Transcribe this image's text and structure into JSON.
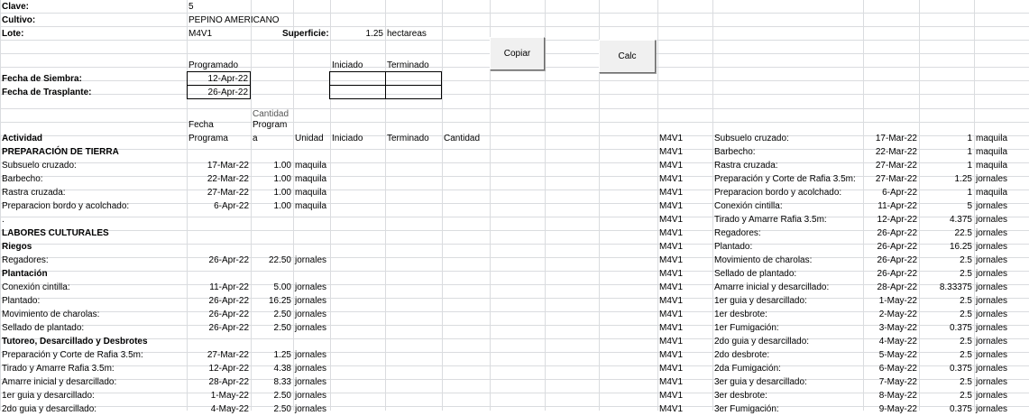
{
  "colors": {
    "grid": "#dadcdf",
    "button_face": "#f0f0f0"
  },
  "header": {
    "clave_label": "Clave:",
    "clave_value": "5",
    "cultivo_label": "Cultivo:",
    "cultivo_value": "PEPINO AMERICANO",
    "lote_label": "Lote:",
    "lote_value": "M4V1",
    "superficie_label": "Superficie:",
    "superficie_value": "1.25",
    "superficie_unit": "hectareas"
  },
  "buttons": {
    "copiar": "Copiar",
    "calc": "Calc"
  },
  "dates": {
    "programado_header": "Programado",
    "iniciado_header": "Iniciado",
    "terminado_header": "Terminado",
    "siembra_label": "Fecha de Siembra:",
    "siembra_value": "12-Apr-22",
    "trasplante_label": "Fecha de Trasplante:",
    "trasplante_value": "26-Apr-22"
  },
  "table_headers": {
    "actividad": "Actividad",
    "fecha_line1": "Fecha",
    "fecha_line2": "Programa",
    "cant_line0": "Cantidad",
    "cant_line1": "Program",
    "cant_line2": "a",
    "unidad": "Unidad",
    "iniciado": "Iniciado",
    "terminado": "Terminado",
    "cantidad": "Cantidad"
  },
  "left_rows": [
    {
      "actividad": "PREPARACIÓN DE TIERRA",
      "bold": true,
      "fecha": "",
      "cantidad": "",
      "unidad": ""
    },
    {
      "actividad": "Subsuelo cruzado:",
      "bold": false,
      "fecha": "17-Mar-22",
      "cantidad": "1.00",
      "unidad": "maquila"
    },
    {
      "actividad": "Barbecho:",
      "bold": false,
      "fecha": "22-Mar-22",
      "cantidad": "1.00",
      "unidad": "maquila"
    },
    {
      "actividad": "Rastra cruzada:",
      "bold": false,
      "fecha": "27-Mar-22",
      "cantidad": "1.00",
      "unidad": "maquila"
    },
    {
      "actividad": "Preparacion bordo y acolchado:",
      "bold": false,
      "fecha": "6-Apr-22",
      "cantidad": "1.00",
      "unidad": "maquila"
    },
    {
      "actividad": ".",
      "bold": false,
      "fecha": "",
      "cantidad": "",
      "unidad": ""
    },
    {
      "actividad": "LABORES CULTURALES",
      "bold": true,
      "fecha": "",
      "cantidad": "",
      "unidad": ""
    },
    {
      "actividad": "Riegos",
      "bold": true,
      "fecha": "",
      "cantidad": "",
      "unidad": ""
    },
    {
      "actividad": "Regadores:",
      "bold": false,
      "fecha": "26-Apr-22",
      "cantidad": "22.50",
      "unidad": "jornales"
    },
    {
      "actividad": "Plantación",
      "bold": true,
      "fecha": "",
      "cantidad": "",
      "unidad": ""
    },
    {
      "actividad": "Conexión cintilla:",
      "bold": false,
      "fecha": "11-Apr-22",
      "cantidad": "5.00",
      "unidad": "jornales"
    },
    {
      "actividad": "Plantado:",
      "bold": false,
      "fecha": "26-Apr-22",
      "cantidad": "16.25",
      "unidad": "jornales"
    },
    {
      "actividad": "Movimiento de charolas:",
      "bold": false,
      "fecha": "26-Apr-22",
      "cantidad": "2.50",
      "unidad": "jornales"
    },
    {
      "actividad": "Sellado de plantado:",
      "bold": false,
      "fecha": "26-Apr-22",
      "cantidad": "2.50",
      "unidad": "jornales"
    },
    {
      "actividad": "Tutoreo, Desarcillado y Desbrotes",
      "bold": true,
      "fecha": "",
      "cantidad": "",
      "unidad": ""
    },
    {
      "actividad": "Preparación y Corte de Rafia 3.5m:",
      "bold": false,
      "fecha": "27-Mar-22",
      "cantidad": "1.25",
      "unidad": "jornales"
    },
    {
      "actividad": "Tirado y Amarre Rafia 3.5m:",
      "bold": false,
      "fecha": "12-Apr-22",
      "cantidad": "4.38",
      "unidad": "jornales"
    },
    {
      "actividad": "Amarre inicial y desarcillado:",
      "bold": false,
      "fecha": "28-Apr-22",
      "cantidad": "8.33",
      "unidad": "jornales"
    },
    {
      "actividad": "1er guia y desarcillado:",
      "bold": false,
      "fecha": "1-May-22",
      "cantidad": "2.50",
      "unidad": "jornales"
    },
    {
      "actividad": "2do guia y desarcillado:",
      "bold": false,
      "fecha": "4-May-22",
      "cantidad": "2.50",
      "unidad": "jornales"
    }
  ],
  "right_rows": [
    {
      "lote": "M4V1",
      "actividad": "Subsuelo cruzado:",
      "fecha": "17-Mar-22",
      "cantidad": "1",
      "unidad": "maquila"
    },
    {
      "lote": "M4V1",
      "actividad": "Barbecho:",
      "fecha": "22-Mar-22",
      "cantidad": "1",
      "unidad": "maquila"
    },
    {
      "lote": "M4V1",
      "actividad": "Rastra cruzada:",
      "fecha": "27-Mar-22",
      "cantidad": "1",
      "unidad": "maquila"
    },
    {
      "lote": "M4V1",
      "actividad": "Preparación y Corte de Rafia 3.5m:",
      "fecha": "27-Mar-22",
      "cantidad": "1.25",
      "unidad": "jornales"
    },
    {
      "lote": "M4V1",
      "actividad": "Preparacion bordo y acolchado:",
      "fecha": "6-Apr-22",
      "cantidad": "1",
      "unidad": "maquila"
    },
    {
      "lote": "M4V1",
      "actividad": "Conexión cintilla:",
      "fecha": "11-Apr-22",
      "cantidad": "5",
      "unidad": "jornales"
    },
    {
      "lote": "M4V1",
      "actividad": "Tirado y Amarre Rafia 3.5m:",
      "fecha": "12-Apr-22",
      "cantidad": "4.375",
      "unidad": "jornales"
    },
    {
      "lote": "M4V1",
      "actividad": "Regadores:",
      "fecha": "26-Apr-22",
      "cantidad": "22.5",
      "unidad": "jornales"
    },
    {
      "lote": "M4V1",
      "actividad": "Plantado:",
      "fecha": "26-Apr-22",
      "cantidad": "16.25",
      "unidad": "jornales"
    },
    {
      "lote": "M4V1",
      "actividad": "Movimiento de charolas:",
      "fecha": "26-Apr-22",
      "cantidad": "2.5",
      "unidad": "jornales"
    },
    {
      "lote": "M4V1",
      "actividad": "Sellado de plantado:",
      "fecha": "26-Apr-22",
      "cantidad": "2.5",
      "unidad": "jornales"
    },
    {
      "lote": "M4V1",
      "actividad": "Amarre inicial y desarcillado:",
      "fecha": "28-Apr-22",
      "cantidad": "8.33375",
      "unidad": "jornales"
    },
    {
      "lote": "M4V1",
      "actividad": "1er guia y desarcillado:",
      "fecha": "1-May-22",
      "cantidad": "2.5",
      "unidad": "jornales"
    },
    {
      "lote": "M4V1",
      "actividad": "1er desbrote:",
      "fecha": "2-May-22",
      "cantidad": "2.5",
      "unidad": "jornales"
    },
    {
      "lote": "M4V1",
      "actividad": "1er Fumigación:",
      "fecha": "3-May-22",
      "cantidad": "0.375",
      "unidad": "jornales"
    },
    {
      "lote": "M4V1",
      "actividad": "2do guia y desarcillado:",
      "fecha": "4-May-22",
      "cantidad": "2.5",
      "unidad": "jornales"
    },
    {
      "lote": "M4V1",
      "actividad": "2do desbrote:",
      "fecha": "5-May-22",
      "cantidad": "2.5",
      "unidad": "jornales"
    },
    {
      "lote": "M4V1",
      "actividad": "2da Fumigación:",
      "fecha": "6-May-22",
      "cantidad": "0.375",
      "unidad": "jornales"
    },
    {
      "lote": "M4V1",
      "actividad": "3er guia y desarcillado:",
      "fecha": "7-May-22",
      "cantidad": "2.5",
      "unidad": "jornales"
    },
    {
      "lote": "M4V1",
      "actividad": "3er desbrote:",
      "fecha": "8-May-22",
      "cantidad": "2.5",
      "unidad": "jornales"
    },
    {
      "lote": "M4V1",
      "actividad": "3er Fumigación:",
      "fecha": "9-May-22",
      "cantidad": "0.375",
      "unidad": "jornales"
    }
  ]
}
